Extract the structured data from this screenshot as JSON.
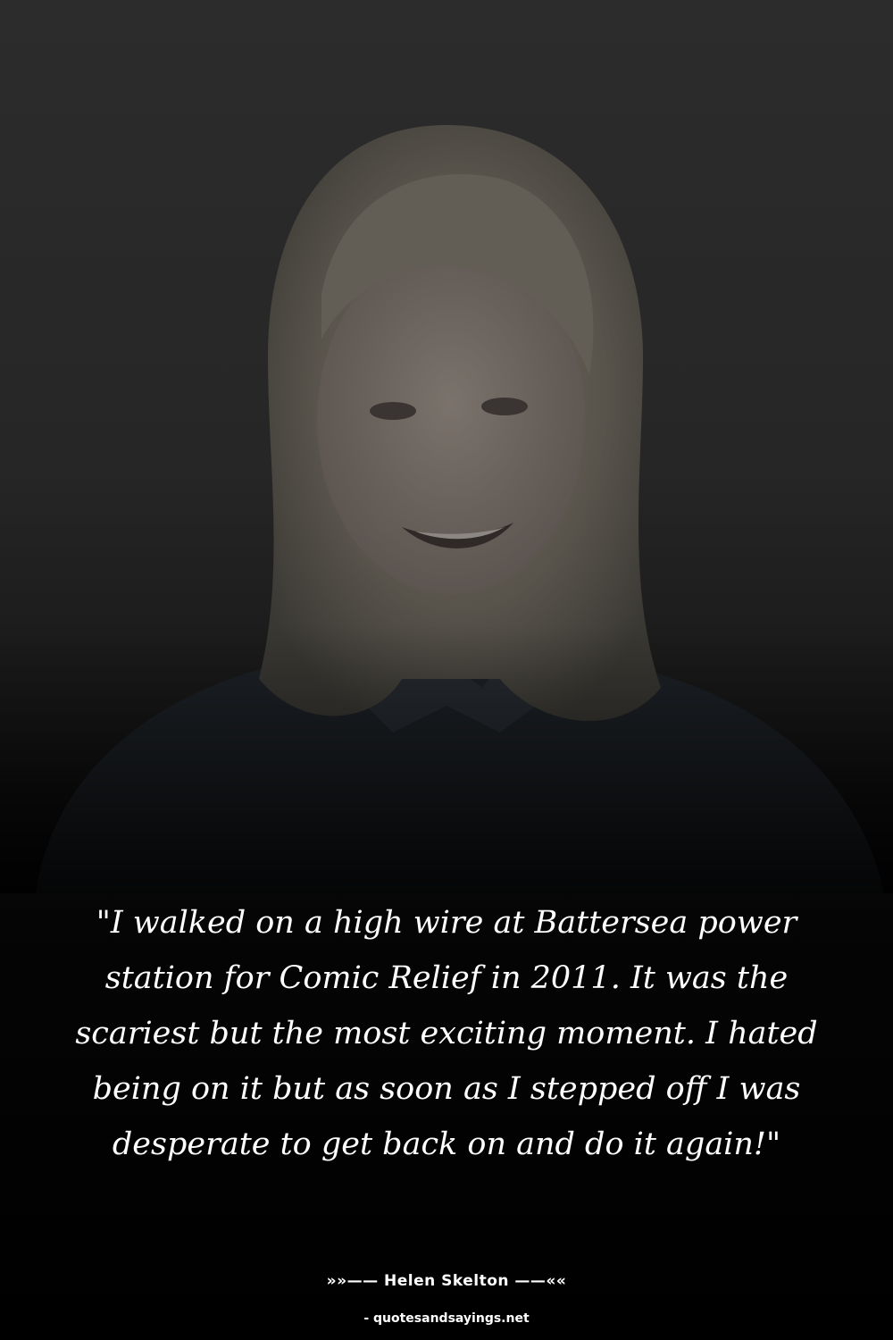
{
  "quote": {
    "text": "\"I walked on a high wire at Battersea power station for Comic Relief in 2011. It was the scariest but the most exciting moment. I hated being on it but as soon as I stepped off I was desperate to get back on and do it again!\""
  },
  "attribution": {
    "author_line": "»»—— Helen Skelton ——««"
  },
  "footer": {
    "site": "- quotesandsayings.net"
  },
  "colors": {
    "background": "#000000",
    "text": "#ffffff"
  }
}
